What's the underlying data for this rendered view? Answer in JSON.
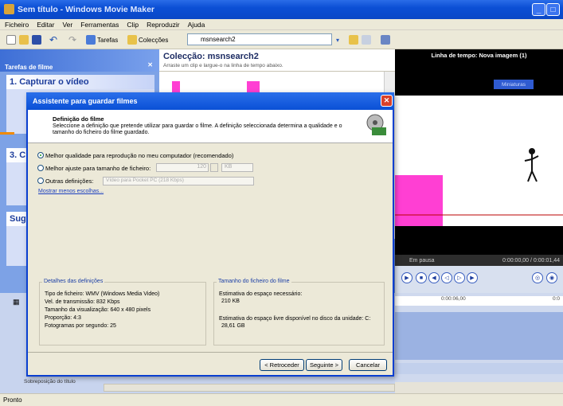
{
  "window": {
    "title": "Sem título - Windows Movie Maker",
    "icon": "movie-maker-icon"
  },
  "menu": [
    "Ficheiro",
    "Editar",
    "Ver",
    "Ferramentas",
    "Clip",
    "Reproduzir",
    "Ajuda"
  ],
  "toolbar": {
    "tasks_label": "Tarefas",
    "collections_label": "Colecções",
    "combo_value": "msnsearch2"
  },
  "tasks": {
    "header": "Tarefas de filme",
    "sections": [
      "1. Capturar o vídeo",
      "3. C",
      "Sug"
    ],
    "sobre_label": "Sobreposição do título"
  },
  "collection": {
    "title": "Colecção: msnsearch2",
    "hint": "Arraste um clip e largue-o na linha de tempo abaixo."
  },
  "preview": {
    "title": "Linha de tempo: Nova imagem (1)",
    "mini_label": "Miniaturas",
    "status": "Em pausa",
    "time": "0:00:00,00 / 0:00:01,44"
  },
  "timeline": {
    "ruler_mark": "0:00:06,00",
    "ruler_mark2": "0:0"
  },
  "statusbar": "Pronto",
  "dialog": {
    "title": "Assistente para guardar filmes",
    "heading": "Definição do filme",
    "description": "Seleccione a definição que pretende utilizar para guardar o filme. A definição seleccionada determina a qualidade e o tamanho do ficheiro do filme guardado.",
    "options": [
      {
        "label": "Melhor qualidade para reprodução no meu computador (recomendado)",
        "selected": true
      },
      {
        "label": "Melhor ajuste para tamanho de ficheiro:",
        "selected": false
      },
      {
        "label": "Outras definições:",
        "selected": false
      }
    ],
    "size_value": "120",
    "size_unit": "KB",
    "other_value": "Vídeo para Pocket PC (218 Kbps)",
    "show_less": "Mostrar menos escolhas...",
    "details": {
      "title": "Detalhes das definições",
      "lines": [
        "Tipo de ficheiro: WMV (Windows Media Video)",
        "Vel. de transmissão: 832 Kbps",
        "Tamanho da visualização: 640 x 480 pixels",
        "Proporção: 4:3",
        "Fotogramas por segundo: 25"
      ]
    },
    "file_size": {
      "title": "Tamanho do ficheiro do filme",
      "needed_label": "Estimativa do espaço necessário:",
      "needed_value": "210 KB",
      "free_label": "Estimativa do espaço livre disponível no disco da unidade: C:",
      "free_value": "28,61 GB"
    },
    "buttons": {
      "back": "< Retroceder",
      "next": "Seguinte >",
      "cancel": "Cancelar"
    }
  }
}
